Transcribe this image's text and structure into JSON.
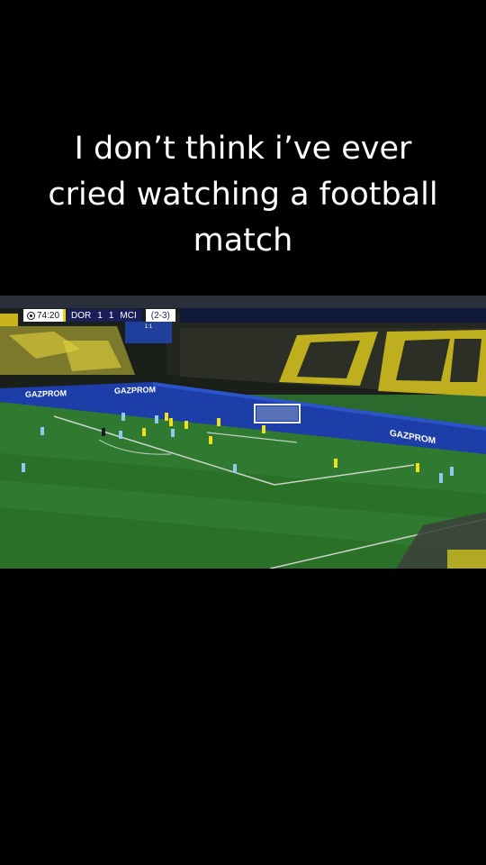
{
  "caption": {
    "line1": "I don’t think i’ve ever",
    "line2": "cried watching a football",
    "line3": "match"
  },
  "scoreboard": {
    "clock": "74:20",
    "home_team": "DOR",
    "home_score": "1",
    "away_score": "1",
    "away_team": "MCI",
    "aggregate": "(2-3)",
    "panel_score": "1:1"
  },
  "board_text": {
    "gazprom": "GAZPROM"
  },
  "colors": {
    "pitch": "#2f7a30",
    "stands_yellow": "#e8d21a",
    "board_blue": "#1d3ea8",
    "kit_yellow": "#f3de1a",
    "kit_blue": "#8ec9ef"
  }
}
